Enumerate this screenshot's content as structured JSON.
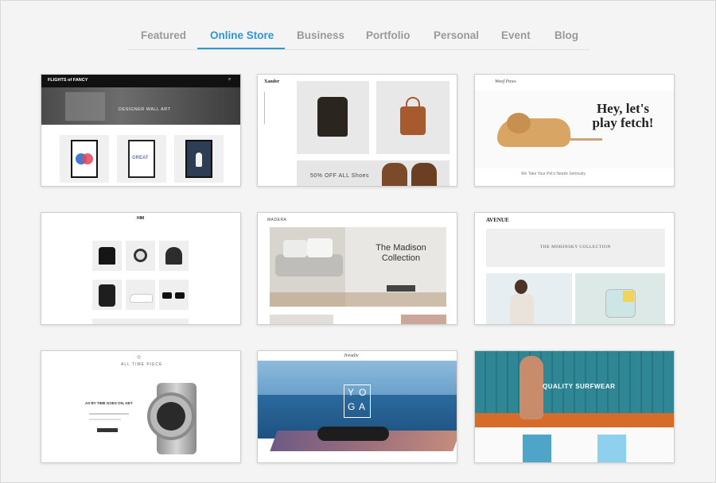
{
  "tabs": [
    {
      "label": "Featured"
    },
    {
      "label": "Online Store"
    },
    {
      "label": "Business"
    },
    {
      "label": "Portfolio"
    },
    {
      "label": "Personal"
    },
    {
      "label": "Event"
    },
    {
      "label": "Blog"
    }
  ],
  "active_tab": "Online Store",
  "templates": [
    {
      "brand": "FLIGHTS of FANCY",
      "headline": "DESIGNER WALL ART",
      "art_text": "GREAT"
    },
    {
      "brand": "Xander",
      "headline": "50% OFF ALL Shoes"
    },
    {
      "brand": "Woof Paws",
      "headline": "Hey, let's play fetch!",
      "tagline": "We Take Your Pet's Needs Seriously"
    },
    {
      "brand": "HIM"
    },
    {
      "brand": "MADERA",
      "headline_1": "The Madison",
      "headline_2": "Collection"
    },
    {
      "brand": "AVENUE",
      "headline": "THE MOHINSKY COLLECTION"
    },
    {
      "brand": "ALL TIME PIECE",
      "headline": "AS BY TIME GOES ON, GET"
    },
    {
      "brand": "Jivvaliv",
      "letters": [
        "Y",
        "O",
        "G",
        "A"
      ]
    },
    {
      "headline": "QUALITY SURFWEAR"
    }
  ],
  "colors": {
    "accent": "#2f95d6",
    "tab_inactive": "#9a9a9a"
  }
}
